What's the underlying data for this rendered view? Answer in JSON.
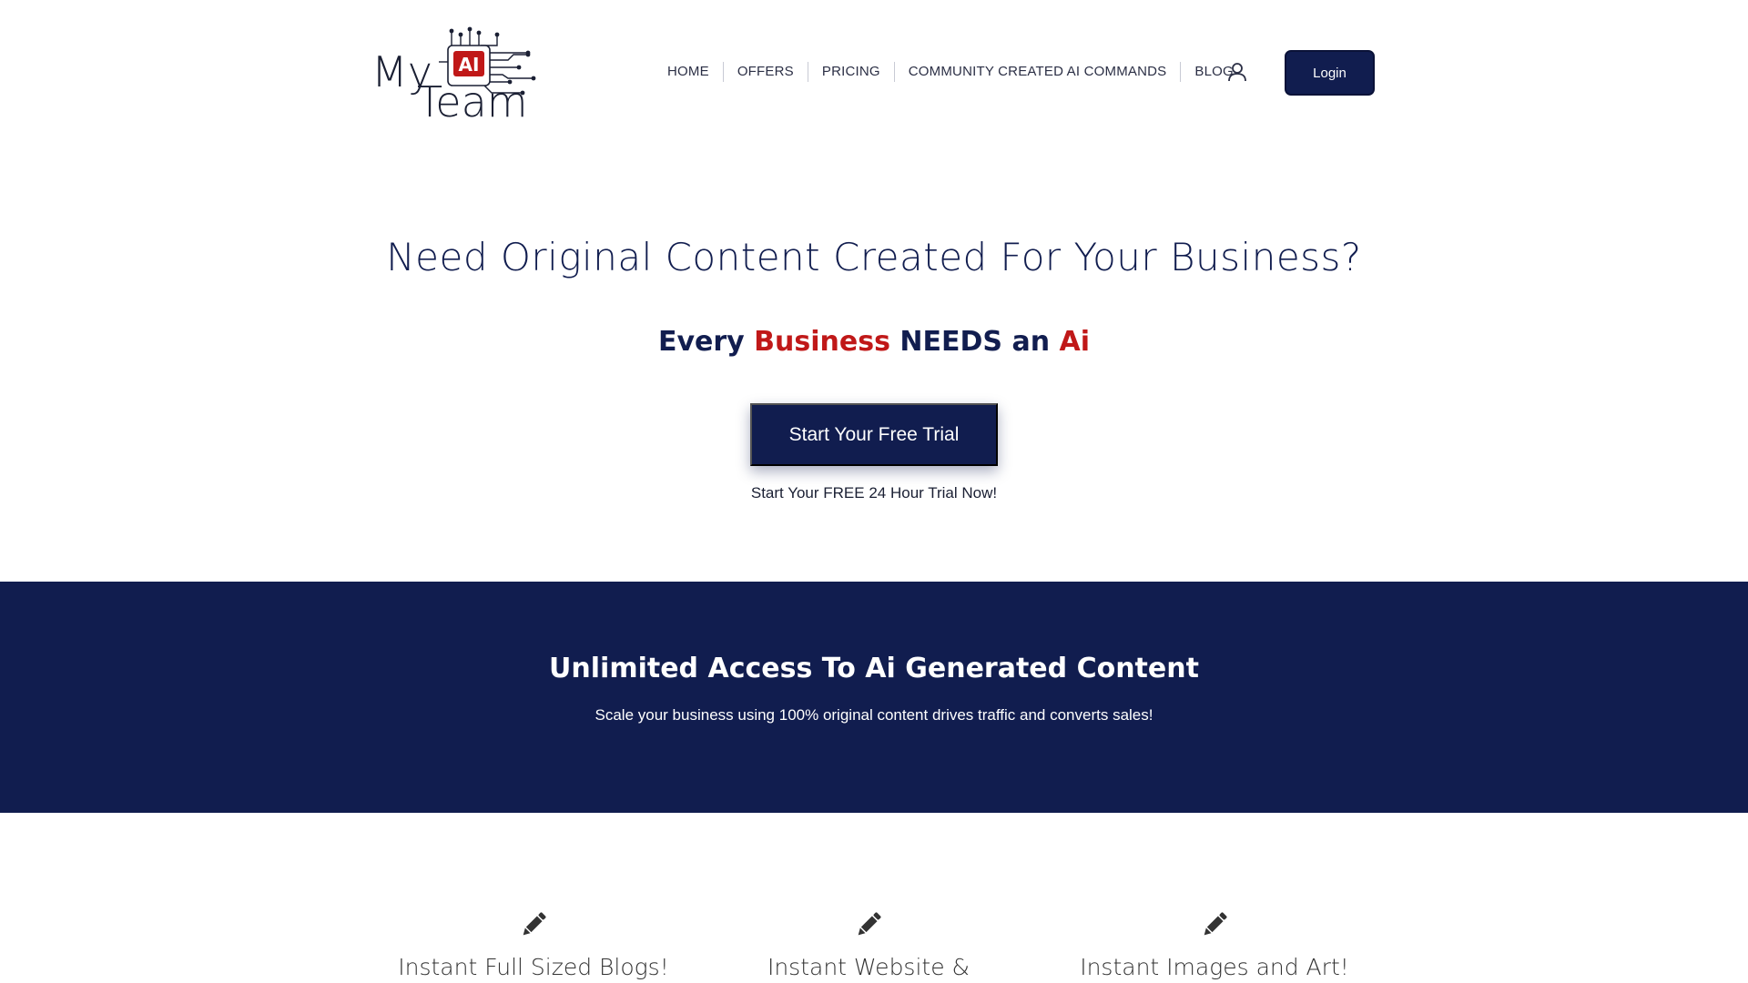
{
  "brand": {
    "logo_text_my": "My",
    "logo_text_ai": "AI",
    "logo_text_team": "Team",
    "primary_color": "#111d4f",
    "accent_color": "#c01818"
  },
  "nav": {
    "items": [
      {
        "label": "HOME"
      },
      {
        "label": "OFFERS"
      },
      {
        "label": "PRICING"
      },
      {
        "label": "COMMUNITY CREATED AI COMMANDS"
      },
      {
        "label": "BLOG"
      }
    ],
    "account_icon": "user-icon",
    "login_label": "Login"
  },
  "hero": {
    "title": "Need Original Content Created For Your Business?",
    "subtitle_part1": "Every ",
    "subtitle_part2": "Business",
    "subtitle_part3": " NEEDS an ",
    "subtitle_part4": "Ai",
    "cta_label": "Start Your Free Trial",
    "cta_note": "Start Your FREE 24 Hour Trial Now!"
  },
  "banner": {
    "title": "Unlimited Access To Ai Generated Content",
    "text": "Scale your business using 100% original content drives traffic and converts sales!"
  },
  "features": [
    {
      "icon": "pencil-icon",
      "title": "Instant Full Sized Blogs!"
    },
    {
      "icon": "pencil-icon",
      "title": "Instant Website &"
    },
    {
      "icon": "pencil-icon",
      "title": "Instant Images and Art!"
    }
  ]
}
